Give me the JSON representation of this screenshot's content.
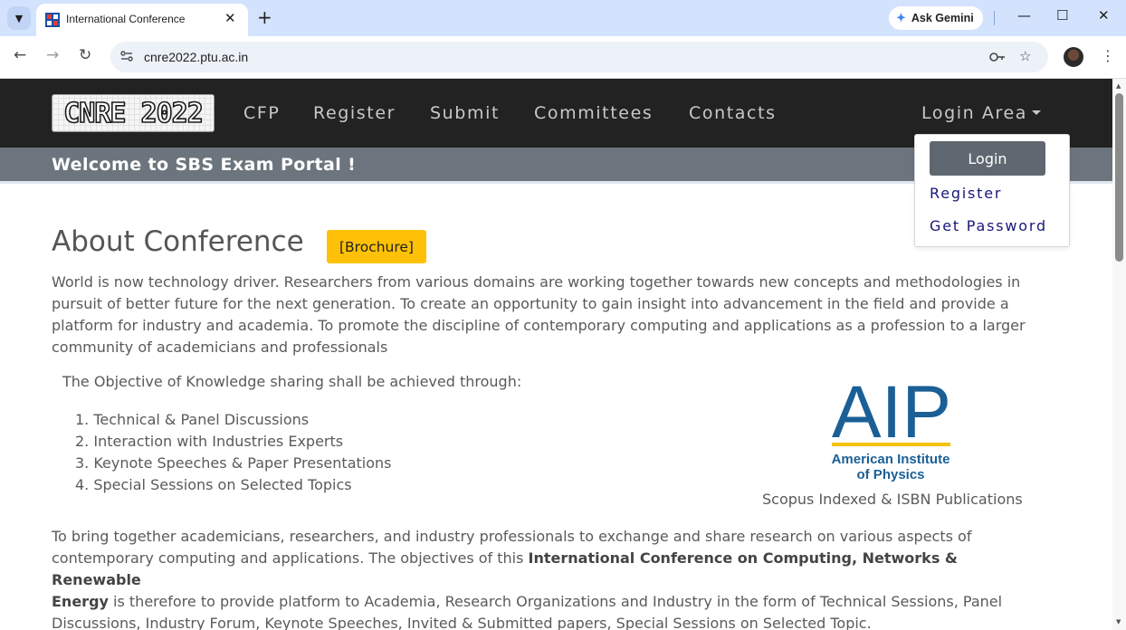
{
  "browser": {
    "tab_title": "International Conference",
    "tab_close_glyph": "✕",
    "new_tab_glyph": "+",
    "ask_gemini": "Ask Gemini",
    "url": "cnre2022.ptu.ac.in",
    "window_controls": {
      "minimize": "—",
      "maximize": "☐",
      "close": "✕"
    },
    "nav": {
      "back": "←",
      "forward": "→",
      "reload": "↻"
    }
  },
  "site": {
    "logo_text": "CNRE 2022",
    "nav_items": [
      "CFP",
      "Register",
      "Submit",
      "Committees",
      "Contacts"
    ],
    "login_area": "Login Area",
    "welcome": "Welcome to SBS Exam Portal !",
    "dropdown": {
      "login": "Login",
      "register": "Register",
      "get_password": "Get Password"
    }
  },
  "main": {
    "about_title": "About Conference",
    "brochure": "[Brochure]",
    "intro_lines": [
      "World is now technology driver. Researchers from various domains are working together towards new concepts and methodologies in",
      "pursuit of better future for the next generation. To create an opportunity to gain insight into advancement in the field and provide a",
      "platform for industry and academia. To promote the discipline of contemporary computing and applications as a profession to a larger",
      "community of academicians and professionals"
    ],
    "objective_heading": "The Objective of Knowledge sharing shall be achieved through:",
    "objectives": [
      "1. Technical & Panel Discussions",
      "2. Interaction with Industries Experts",
      "3. Keynote Speeches & Paper Presentations",
      "4. Special Sessions on Selected Topics"
    ],
    "aip_logo": {
      "letters": "AIP",
      "line1": "American Institute",
      "line2": "of Physics"
    },
    "aip_caption": "Scopus Indexed & ISBN Publications",
    "bring_line1": "To bring together academicians, researchers, and industry professionals to exchange and share research on various aspects of",
    "bring_line2_a": "contemporary computing and applications. The objectives of this ",
    "bring_line2_bold": "International Conference on Computing, Networks & Renewable",
    "bring_line3_bold": "Energy",
    "bring_line3_b": " is therefore to provide platform to Academia, Research Organizations and Industry in the form of Technical Sessions, Panel",
    "bring_line4": "Discussions, Industry Forum, Keynote Speeches, Invited & Submitted papers, Special Sessions on Selected Topic."
  },
  "colors": {
    "navbar": "#222222",
    "welcome_bar": "#6c757d",
    "brochure": "#ffc107",
    "aip_blue": "#1a5f96",
    "aip_gold": "#f4c20d"
  }
}
